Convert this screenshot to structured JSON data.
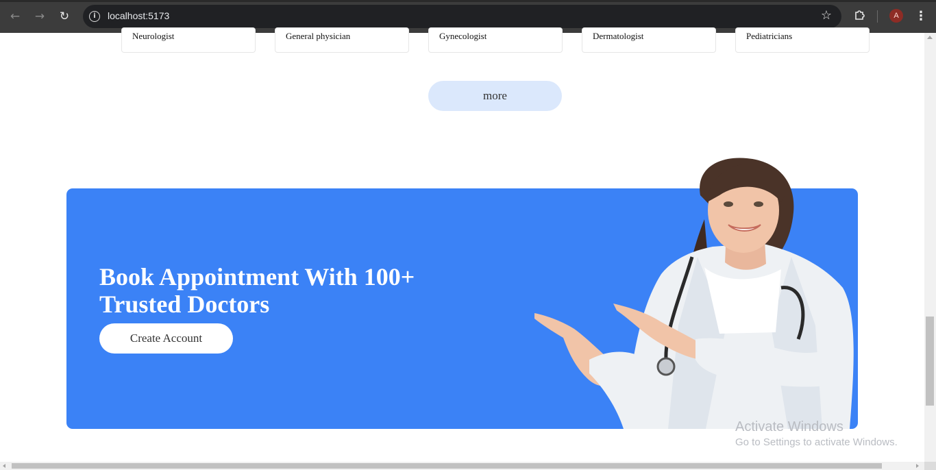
{
  "browser": {
    "url": "localhost:5173",
    "profile_initial": "A",
    "icons": {
      "back": "back-arrow-icon",
      "forward": "forward-arrow-icon",
      "reload": "reload-icon",
      "site_info": "info-icon",
      "bookmark": "star-icon",
      "extensions": "puzzle-icon",
      "menu": "kebab-menu-icon"
    }
  },
  "specialities": [
    {
      "label": "Neurologist"
    },
    {
      "label": "General physician"
    },
    {
      "label": "Gynecologist"
    },
    {
      "label": "Dermatologist"
    },
    {
      "label": "Pediatricians"
    }
  ],
  "more_button": "more",
  "banner": {
    "title_line1": "Book Appointment With 100+",
    "title_line2": "Trusted Doctors",
    "cta": "Create Account",
    "color": "#3b82f6"
  },
  "watermark": {
    "line1": "Activate Windows",
    "line2": "Go to Settings to activate Windows."
  }
}
